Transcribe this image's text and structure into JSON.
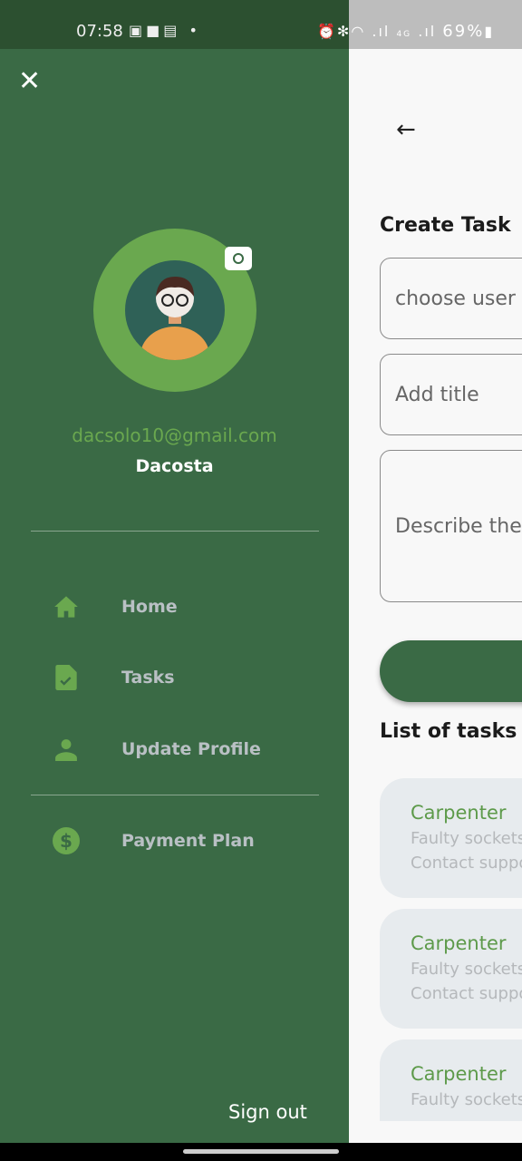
{
  "status_bar": {
    "time": "07:58",
    "battery": "69%",
    "network": "4G"
  },
  "drawer": {
    "email": "dacsolo10@gmail.com",
    "name": "Dacosta",
    "items": [
      {
        "label": "Home",
        "icon": "home-icon"
      },
      {
        "label": "Tasks",
        "icon": "task-document-icon"
      },
      {
        "label": "Update Profile",
        "icon": "person-icon"
      },
      {
        "label": "Payment Plan",
        "icon": "dollar-icon"
      }
    ],
    "sign_out": "Sign out"
  },
  "main": {
    "title": "Create Task",
    "user_placeholder": "choose user",
    "title_placeholder": "Add title",
    "description_placeholder": "Describe the task",
    "list_title": "List of tasks",
    "tasks": [
      {
        "category": "Carpenter",
        "title": "Faulty sockets",
        "note": "Contact support"
      },
      {
        "category": "Carpenter",
        "title": "Faulty sockets",
        "note": "Contact support"
      },
      {
        "category": "Carpenter",
        "title": "Faulty sockets",
        "note": ""
      }
    ]
  },
  "colors": {
    "primary": "#3a6a45",
    "accent": "#6aa84f"
  }
}
